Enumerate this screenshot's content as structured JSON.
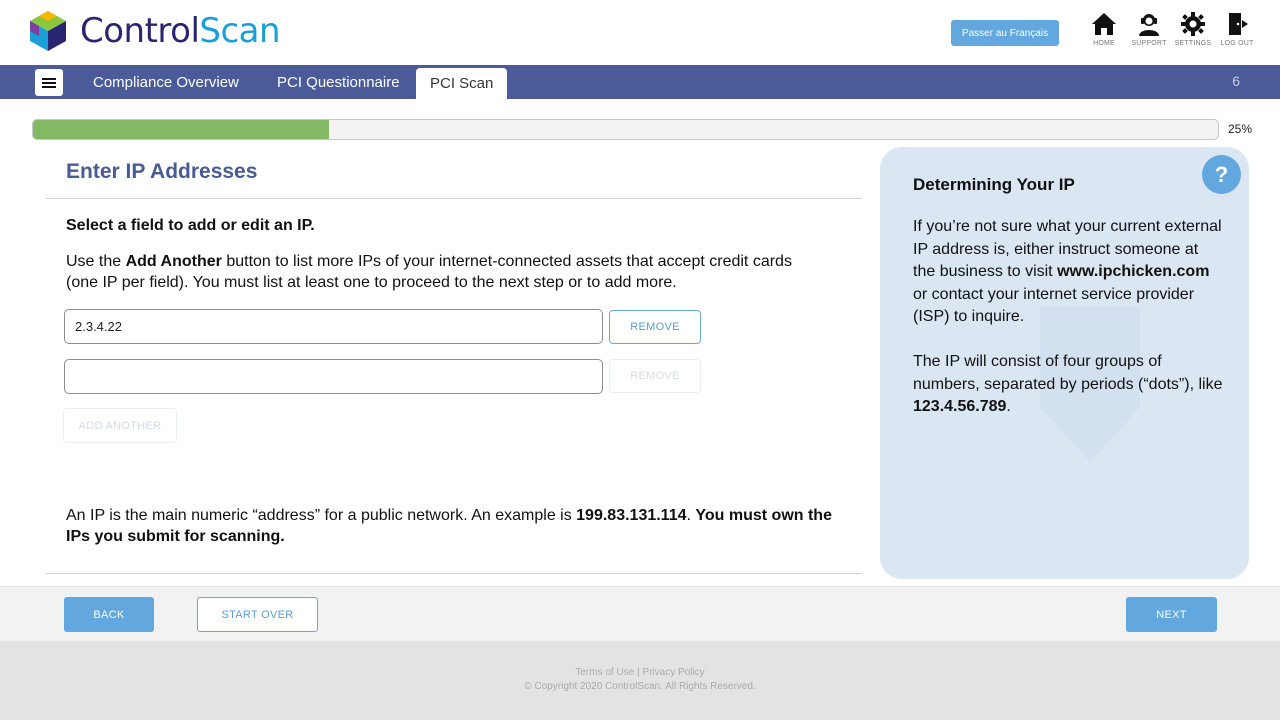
{
  "header": {
    "brand_part1": "Control",
    "brand_part2": "Scan",
    "language_button": "Passer au Français",
    "icons": [
      {
        "name": "home-icon",
        "label": "HOME"
      },
      {
        "name": "support-icon",
        "label": "SUPPORT"
      },
      {
        "name": "settings-icon",
        "label": "SETTINGS"
      },
      {
        "name": "logout-icon",
        "label": "LOG OUT"
      }
    ]
  },
  "nav": {
    "tabs": [
      {
        "label": "Compliance Overview",
        "active": false
      },
      {
        "label": "PCI Questionnaire",
        "active": false
      },
      {
        "label": "PCI Scan",
        "active": true
      }
    ],
    "count": "6"
  },
  "progress": {
    "value": 0.25,
    "label": "25%"
  },
  "main": {
    "title": "Enter IP Addresses",
    "instruction": "Select a field to add or edit an IP.",
    "desc_pre": "Use the ",
    "desc_bold": "Add Another",
    "desc_post": " button to list more IPs of your internet-connected assets that accept credit cards (one IP per field). You must list at least one to proceed to the next step or to add more.",
    "ip_fields": [
      {
        "value": "2.3.4.22",
        "remove_label": "REMOVE",
        "remove_enabled": true
      },
      {
        "value": "",
        "remove_label": "REMOVE",
        "remove_enabled": false
      }
    ],
    "add_another": "ADD ANOTHER",
    "note_pre": "An IP is the main numeric “address” for a public network. An example is ",
    "note_example": "199.83.131.114",
    "note_mid": ". ",
    "note_bold": "You must own the IPs you submit for scanning."
  },
  "side": {
    "help": "?",
    "title": "Determining Your IP",
    "p1_pre": "If you’re not sure what your current external IP address is, either instruct someone at the business to visit ",
    "p1_link": "www.ipchicken.com",
    "p1_post": " or contact your internet service provider (ISP) to inquire.",
    "p2_pre": "The IP will consist of four groups of numbers, separated by periods (“dots”), like ",
    "p2_example": "123.4.56.789",
    "p2_post": "."
  },
  "buttons": {
    "back": "BACK",
    "start_over": "START OVER",
    "next": "NEXT"
  },
  "footer": {
    "terms": "Terms of Use",
    "sep": " | ",
    "privacy": "Privacy Policy",
    "copyright": "© Copyright 2020 ControlScan. All Rights Reserved."
  },
  "colors": {
    "nav": "#4b5b9a",
    "accent": "#62a8df",
    "progress": "#83b964",
    "side_panel": "#dbe6f3"
  }
}
